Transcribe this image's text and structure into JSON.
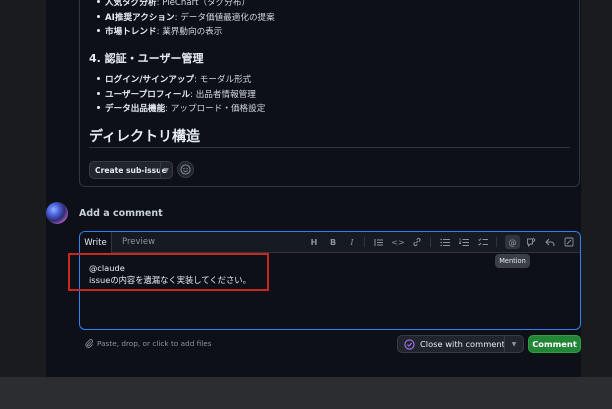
{
  "issue_body": {
    "analytics_bullets": [
      {
        "bold": "人気タグ分析",
        "rest": ": PieChart（タグ分布）"
      },
      {
        "bold": "AI推奨アクション",
        "rest": ": データ価値最適化の提案"
      },
      {
        "bold": "市場トレンド",
        "rest": ": 業界動向の表示"
      }
    ],
    "auth_heading": "4. 認証・ユーザー管理",
    "auth_bullets": [
      {
        "bold": "ログイン/サインアップ",
        "rest": ": モーダル形式"
      },
      {
        "bold": "ユーザープロフィール",
        "rest": ": 出品者情報管理"
      },
      {
        "bold": "データ出品機能",
        "rest": ": アップロード・価格設定"
      }
    ],
    "directory_heading": "ディレクトリ構造",
    "create_subissue_label": "Create sub-issue"
  },
  "comment": {
    "heading": "Add a comment",
    "tabs": {
      "write": "Write",
      "preview": "Preview"
    },
    "toolbar_icons": [
      "heading-icon",
      "bold-icon",
      "italic-icon",
      "quote-icon",
      "code-icon",
      "link-icon",
      "unordered-list-icon",
      "ordered-list-icon",
      "task-list-icon",
      "mention-icon",
      "reference-icon",
      "reply-icon",
      "fullscreen-icon"
    ],
    "tooltip": "Mention",
    "text_line1": "@claude",
    "text_line2": "issueの内容を遺漏なく実装してください。",
    "paste_hint": "Paste, drop, or click to add files",
    "close_label": "Close with comment",
    "submit_label": "Comment"
  },
  "colors": {
    "accent": "#2f81f7",
    "submit": "#238636",
    "highlight_box": "#c8281e"
  }
}
